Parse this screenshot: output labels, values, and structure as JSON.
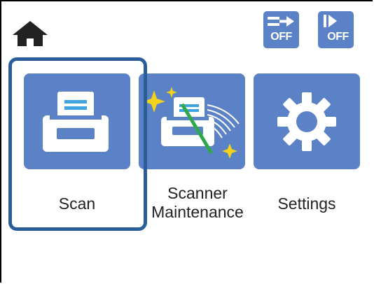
{
  "header": {
    "home_icon": "home-icon",
    "buttons": [
      {
        "name": "sleep-off-button",
        "icon": "arrow-right-icon",
        "label": "OFF"
      },
      {
        "name": "skip-off-button",
        "icon": "skip-forward-icon",
        "label": "OFF"
      }
    ]
  },
  "menu": {
    "selected": "scan",
    "items": [
      {
        "id": "scan",
        "icon": "scanner-icon",
        "label_lines": [
          "Scan"
        ]
      },
      {
        "id": "scanner-maintenance",
        "icon": "scanner-cleaning-icon",
        "label_lines": [
          "Scanner",
          "Maintenance"
        ]
      },
      {
        "id": "settings",
        "icon": "gear-icon",
        "label_lines": [
          "Settings"
        ]
      }
    ]
  },
  "colors": {
    "tile": "#5b82c7",
    "focus": "#2a5d99",
    "accent_green": "#2ea84a",
    "sparkle": "#f2d21c"
  }
}
